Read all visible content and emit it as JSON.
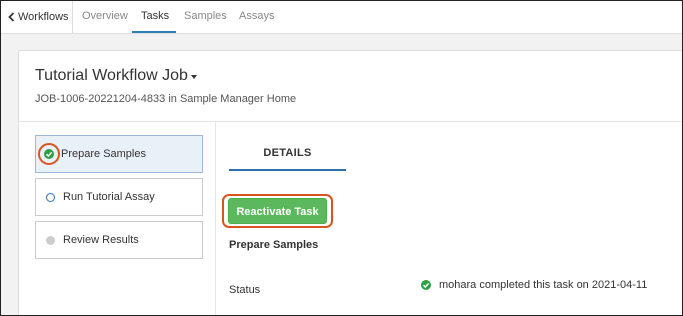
{
  "nav": {
    "back_label": "Workflows",
    "tabs": [
      {
        "label": "Overview",
        "active": false
      },
      {
        "label": "Tasks",
        "active": true
      },
      {
        "label": "Samples",
        "active": false
      },
      {
        "label": "Assays",
        "active": false
      }
    ]
  },
  "job": {
    "title": "Tutorial Workflow Job",
    "subtitle": "JOB-1006-20221204-4833 in Sample Manager Home"
  },
  "tasks": [
    {
      "label": "Prepare Samples",
      "status": "completed",
      "selected": true
    },
    {
      "label": "Run Tutorial Assay",
      "status": "open",
      "selected": false
    },
    {
      "label": "Review Results",
      "status": "pending",
      "selected": false
    }
  ],
  "details": {
    "tab_label": "DETAILS",
    "button_label": "Reactivate Task",
    "section_title": "Prepare Samples",
    "status_label": "Status",
    "status_value": "mohara completed this task on 2021-04-11"
  },
  "colors": {
    "accent": "#2a6fb0",
    "success": "#5cb85c",
    "highlight": "#d9541e"
  }
}
